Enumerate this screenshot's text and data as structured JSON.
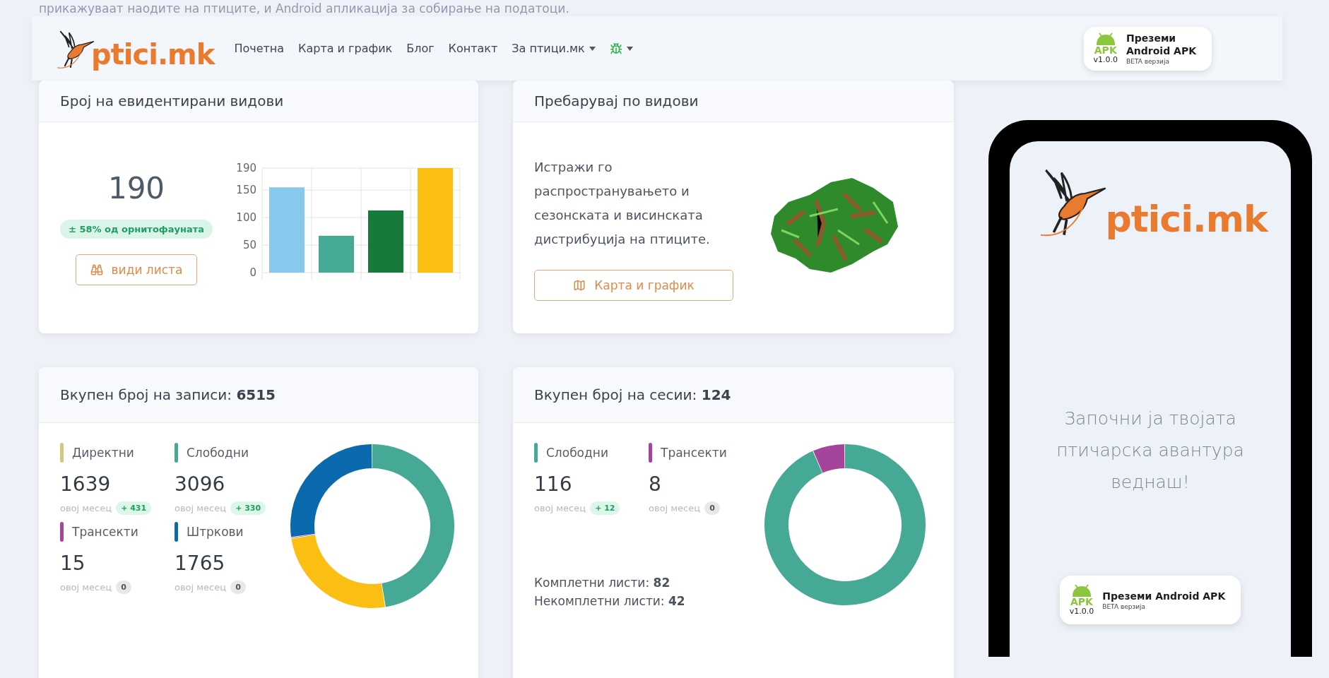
{
  "intro_text": "прикажуваат наодите на птиците, и Android апликација за собирање на податоци.",
  "header": {
    "logo_text": "ptici.mk",
    "nav": [
      {
        "label": "Почетна",
        "dropdown": false
      },
      {
        "label": "Карта и график",
        "dropdown": false
      },
      {
        "label": "Блог",
        "dropdown": false
      },
      {
        "label": "Контакт",
        "dropdown": false
      },
      {
        "label": "За птици.мк",
        "dropdown": true
      }
    ],
    "apk": {
      "icon_label": "APK",
      "version": "v1.0.0",
      "line1": "Преземи",
      "line2": "Android APK",
      "beta": "BETA верзија"
    }
  },
  "species_card": {
    "title": "Број на евидентирани видови",
    "count": "190",
    "badge": "± 58% од орнитофауната",
    "button": "види листа",
    "chart_data": {
      "type": "bar",
      "grid": true,
      "values": [
        155,
        67,
        113,
        190
      ],
      "colors": [
        "#87c9ec",
        "#45a995",
        "#17793a",
        "#fbbf14"
      ],
      "ylim": [
        0,
        190
      ],
      "yticks": [
        0,
        50,
        100,
        150,
        190
      ]
    }
  },
  "search_card": {
    "title": "Пребарувај по видови",
    "text": "Истражи го распространувањето и сезонската и висинската дистрибуција на птиците.",
    "button": "Карта и график"
  },
  "records_card": {
    "title": "Вкупен број на записи: **6515**",
    "stats": [
      {
        "label": "Директни",
        "color": "#d4c77a",
        "value": "1639",
        "period": "овој месец",
        "change": "+ 431",
        "positive": true
      },
      {
        "label": "Слободни",
        "color": "#45a995",
        "value": "3096",
        "period": "овој месец",
        "change": "+ 330",
        "positive": true
      },
      {
        "label": "Трансекти",
        "color": "#a4449a",
        "value": "15",
        "period": "овој месец",
        "change": "0",
        "positive": false
      },
      {
        "label": "Штркови",
        "color": "#0a6aad",
        "value": "1765",
        "period": "овој месец",
        "change": "0",
        "positive": false
      }
    ],
    "chart_data": {
      "type": "donut",
      "values": [
        47.52,
        25.16,
        0.23,
        27.09
      ],
      "colors": [
        "#45a995",
        "#fbbf14",
        "#a4449a",
        "#0a6aad"
      ]
    }
  },
  "sessions_card": {
    "title": "Вкупен број на сесии: **124**",
    "stats": [
      {
        "label": "Слободни",
        "color": "#45a995",
        "value": "116",
        "period": "овој месец",
        "change": "+ 12",
        "positive": true
      },
      {
        "label": "Трансекти",
        "color": "#a4449a",
        "value": "8",
        "period": "овој месец",
        "change": "0",
        "positive": false
      }
    ],
    "lists": [
      "Комплетни листи: **82**",
      "Некомплетни листи: **42**"
    ],
    "chart_data": {
      "type": "donut",
      "values": [
        93.55,
        6.45
      ],
      "colors": [
        "#45a995",
        "#a4449a"
      ]
    }
  },
  "phone": {
    "logo_text": "ptici.mk",
    "tagline": "Започни ја твојата птичарска авантура веднаш!",
    "apk": {
      "icon_label": "APK",
      "version": "v1.0.0",
      "title": "Преземи Android APK",
      "beta": "BETA верзија"
    }
  }
}
